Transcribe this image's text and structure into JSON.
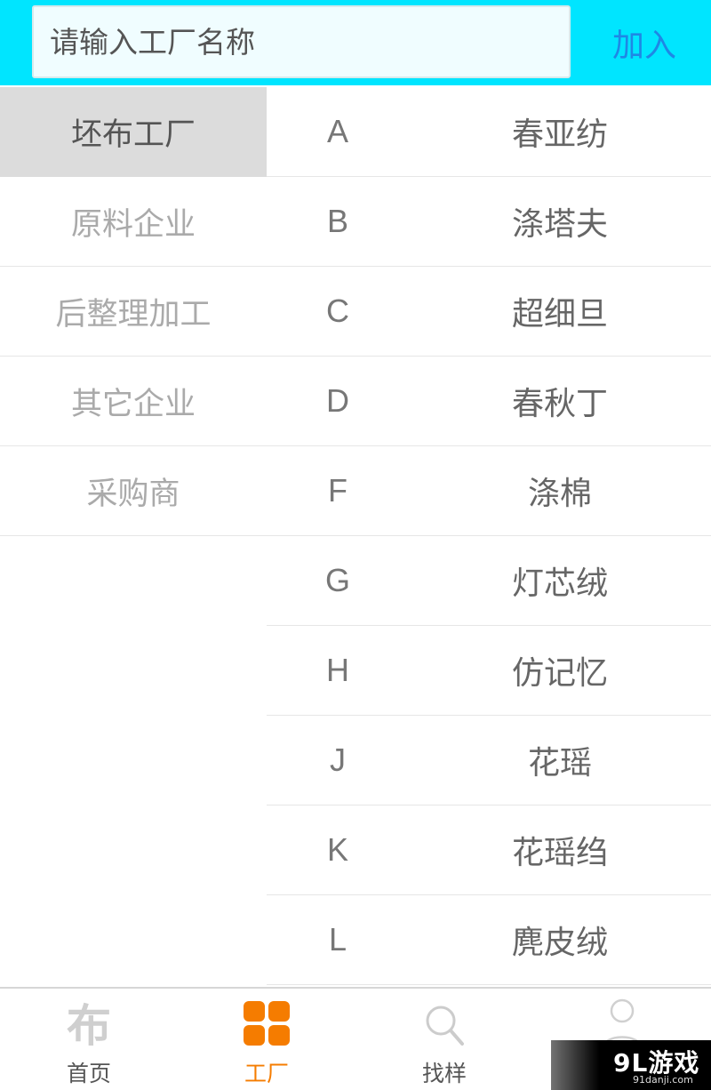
{
  "search": {
    "placeholder": "请输入工厂名称",
    "join_label": "加入"
  },
  "categories": [
    {
      "label": "坯布工厂",
      "active": true
    },
    {
      "label": "原料企业",
      "active": false
    },
    {
      "label": "后整理加工",
      "active": false
    },
    {
      "label": "其它企业",
      "active": false
    },
    {
      "label": "采购商",
      "active": false
    }
  ],
  "list": [
    {
      "letter": "A",
      "name": "春亚纺"
    },
    {
      "letter": "B",
      "name": "涤塔夫"
    },
    {
      "letter": "C",
      "name": "超细旦"
    },
    {
      "letter": "D",
      "name": "春秋丁"
    },
    {
      "letter": "F",
      "name": "涤棉"
    },
    {
      "letter": "G",
      "name": "灯芯绒"
    },
    {
      "letter": "H",
      "name": "仿记忆"
    },
    {
      "letter": "J",
      "name": "花瑶"
    },
    {
      "letter": "K",
      "name": "花瑶绉"
    },
    {
      "letter": "L",
      "name": "麂皮绒"
    }
  ],
  "nav": {
    "home_icon_glyph": "布",
    "home_label": "首页",
    "factory_label": "工厂",
    "sample_label": "找样"
  },
  "watermark": {
    "main": "9L游戏",
    "sub": "91danji.com"
  },
  "colors": {
    "topbar": "#00e5ff",
    "accent_blue": "#1e88e5",
    "accent_orange": "#f57c00",
    "active_category_bg": "#dcdcdc"
  }
}
